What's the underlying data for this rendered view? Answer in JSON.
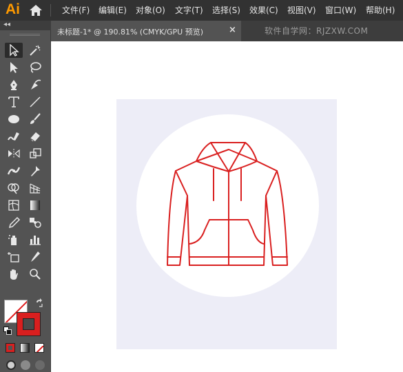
{
  "app": {
    "logo": "Ai"
  },
  "menu": {
    "items": [
      "文件(F)",
      "编辑(E)",
      "对象(O)",
      "文字(T)",
      "选择(S)",
      "效果(C)",
      "视图(V)",
      "窗口(W)",
      "帮助(H)"
    ]
  },
  "tab": {
    "title": "未标题-1* @ 190.81% (CMYK/GPU 预览)",
    "close": "×"
  },
  "watermark": "软件自学网：RJZXW.COM",
  "toolbar": {
    "collapse": "◂◂",
    "tools": [
      "selection-tool",
      "magic-wand-tool",
      "direct-selection-tool",
      "lasso-tool",
      "pen-tool",
      "curvature-tool",
      "type-tool",
      "line-tool",
      "ellipse-tool",
      "paintbrush-tool",
      "pencil-tool",
      "eraser-tool",
      "rotate-tool",
      "scale-tool",
      "warp-tool",
      "free-transform-tool",
      "shape-builder-tool",
      "perspective-grid-tool",
      "mesh-tool",
      "gradient-tool",
      "eyedropper-tool",
      "blend-tool",
      "symbol-sprayer-tool",
      "column-graph-tool",
      "artboard-tool",
      "slice-tool",
      "hand-tool",
      "zoom-tool"
    ],
    "active_tool": "selection-tool"
  },
  "colors": {
    "menubar": "#323232",
    "toolbar": "#535353",
    "tab_active": "#535353",
    "artboard": "#ededf7",
    "stroke": "#d91f1f",
    "logo": "#ff9a00"
  }
}
